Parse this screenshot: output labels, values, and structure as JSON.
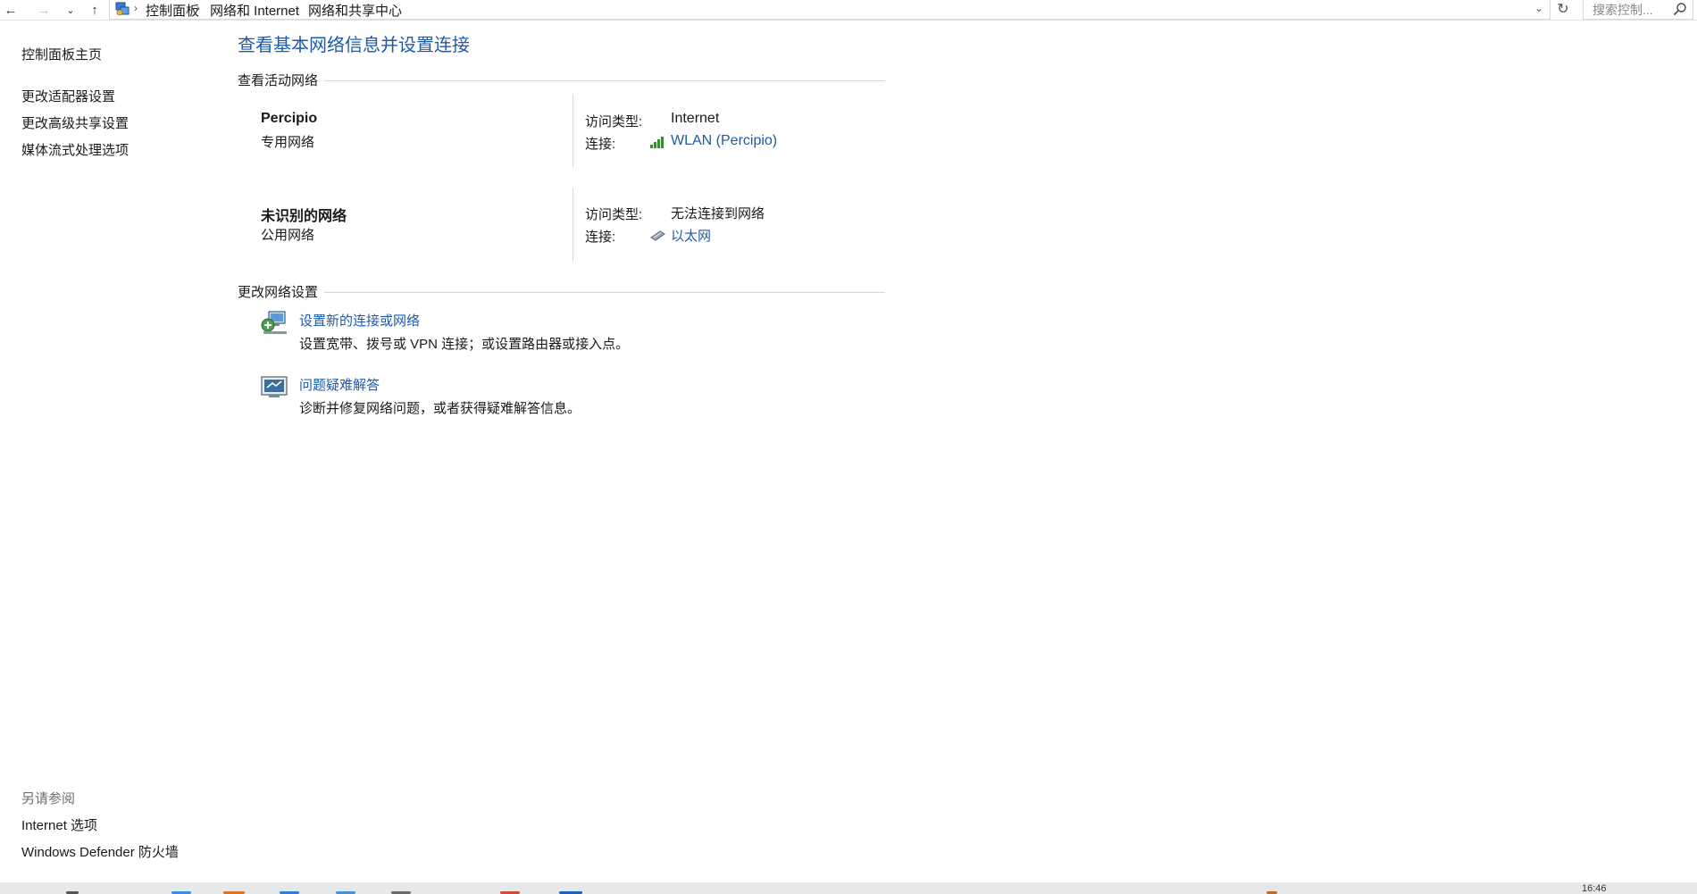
{
  "addressbar": {
    "breadcrumb": [
      "控制面板",
      "网络和 Internet",
      "网络和共享中心"
    ],
    "search_placeholder": "搜索控制..."
  },
  "sidebar": {
    "items": [
      {
        "label": "控制面板主页"
      },
      {
        "label": "更改适配器设置"
      },
      {
        "label": "更改高级共享设置"
      },
      {
        "label": "媒体流式处理选项"
      }
    ],
    "see_also": {
      "title": "另请参阅",
      "items": [
        {
          "label": "Internet 选项"
        },
        {
          "label": "Windows Defender 防火墙"
        }
      ]
    }
  },
  "main": {
    "title": "查看基本网络信息并设置连接",
    "active_networks": {
      "header": "查看活动网络",
      "networks": [
        {
          "name": "Percipio",
          "category": "专用网络",
          "access_label": "访问类型:",
          "access_value": "Internet",
          "conn_label": "连接:",
          "conn_value": "WLAN (Percipio)",
          "conn_icon": "wifi-signal-icon"
        },
        {
          "name": "未识别的网络",
          "category": "公用网络",
          "access_label": "访问类型:",
          "access_value": "无法连接到网络",
          "conn_label": "连接:",
          "conn_value": "以太网",
          "conn_icon": "ethernet-icon"
        }
      ]
    },
    "change_settings": {
      "header": "更改网络设置",
      "tasks": [
        {
          "label": "设置新的连接或网络",
          "desc": "设置宽带、拨号或 VPN 连接；或设置路由器或接入点。",
          "icon": "new-connection-icon"
        },
        {
          "label": "问题疑难解答",
          "desc": "诊断并修复网络问题，或者获得疑难解答信息。",
          "icon": "troubleshoot-icon"
        }
      ]
    }
  },
  "taskbar": {
    "clock": "16:46"
  },
  "colors": {
    "link": "#1e5aa8",
    "title": "#1e5aa8",
    "divider": "#d6d6d6"
  }
}
